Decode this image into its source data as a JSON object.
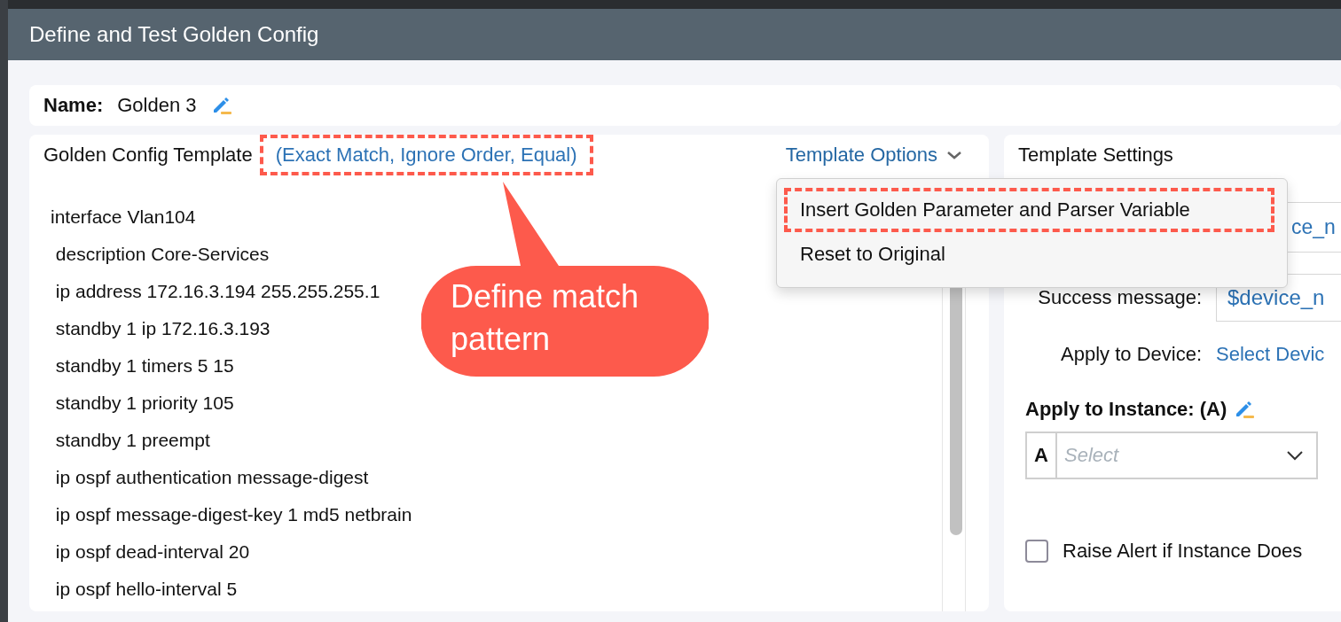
{
  "window": {
    "title": "Define and Test Golden Config"
  },
  "name": {
    "label": "Name:",
    "value": "Golden 3"
  },
  "template": {
    "title": "Golden Config Template",
    "match_pattern": "(Exact Match, Ignore Order, Equal)",
    "options_label": "Template Options",
    "lines": [
      "interface Vlan104",
      " description Core-Services",
      " ip address 172.16.3.194 255.255.255.1",
      " standby 1 ip 172.16.3.193",
      " standby 1 timers 5 15",
      " standby 1 priority 105",
      " standby 1 preempt",
      " ip ospf authentication message-digest",
      " ip ospf message-digest-key 1 md5 netbrain",
      " ip ospf dead-interval 20",
      " ip ospf hello-interval 5"
    ]
  },
  "options_menu": {
    "items": [
      {
        "label": "Insert Golden Parameter and Parser Variable",
        "highlighted": true
      },
      {
        "label": "Reset to Original",
        "highlighted": false
      }
    ]
  },
  "settings": {
    "title": "Template Settings",
    "field_value": "ce_n",
    "success_label": "Success message:",
    "success_value": "$device_n",
    "apply_device_label": "Apply to Device:",
    "apply_device_link": "Select Devic",
    "apply_instance_label": "Apply to Instance: (A)",
    "instance_prefix": "A",
    "instance_placeholder": "Select",
    "raise_alert": {
      "label": "Raise Alert if Instance Does",
      "checked": false
    }
  },
  "callout": {
    "text": "Define match pattern"
  }
}
